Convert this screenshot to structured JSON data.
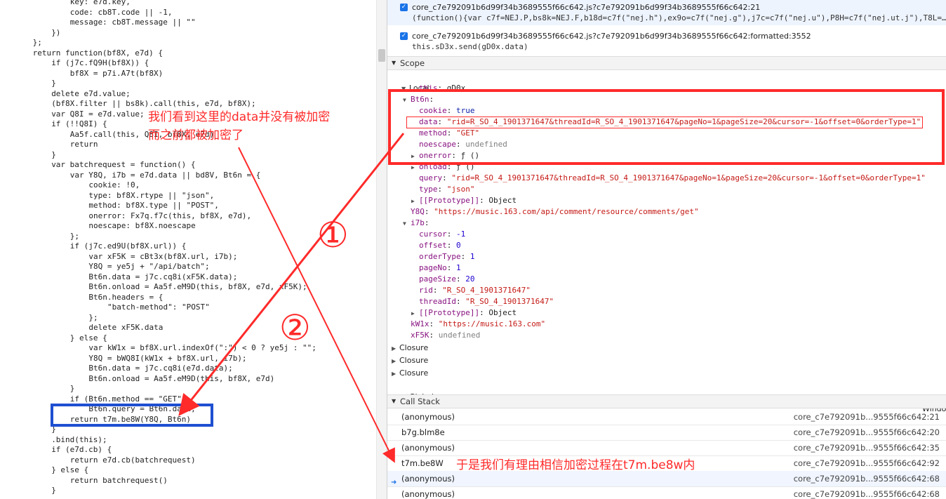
{
  "source_code": [
    {
      "indent": 12,
      "text": "key: e7d.key,"
    },
    {
      "indent": 12,
      "text": "code: cb8T.code || -1,"
    },
    {
      "indent": 12,
      "text": "message: cb8T.message || \"\""
    },
    {
      "indent": 8,
      "text": "})"
    },
    {
      "indent": 4,
      "text": "};"
    },
    {
      "indent": 4,
      "text": "return function(bf8X, e7d) {"
    },
    {
      "indent": 8,
      "text": "if (j7c.fQ9H(bf8X)) {"
    },
    {
      "indent": 12,
      "text": "bf8X = p7i.A7t(bf8X)"
    },
    {
      "indent": 8,
      "text": "}"
    },
    {
      "indent": 8,
      "text": "delete e7d.value;"
    },
    {
      "indent": 8,
      "text": "(bf8X.filter || bs8k).call(this, e7d, bf8X);"
    },
    {
      "indent": 8,
      "text": "var Q8I = e7d.value;"
    },
    {
      "indent": 8,
      "text": "if (!!Q8I) {"
    },
    {
      "indent": 12,
      "text": "Aa5f.call(this, Q8I, bf8X, e7d)"
    },
    {
      "indent": 12,
      "text": "return"
    },
    {
      "indent": 8,
      "text": "}"
    },
    {
      "indent": 8,
      "text": "var batchrequest = function() {"
    },
    {
      "indent": 12,
      "text": "var Y8Q, i7b = e7d.data || bd8V, Bt6n = {"
    },
    {
      "indent": 16,
      "text": "cookie: !0,"
    },
    {
      "indent": 16,
      "text": "type: bf8X.rtype || \"json\","
    },
    {
      "indent": 16,
      "text": "method: bf8X.type || \"POST\","
    },
    {
      "indent": 16,
      "text": "onerror: Fx7q.f7c(this, bf8X, e7d),"
    },
    {
      "indent": 16,
      "text": "noescape: bf8X.noescape"
    },
    {
      "indent": 12,
      "text": "};"
    },
    {
      "indent": 12,
      "text": "if (j7c.ed9U(bf8X.url)) {"
    },
    {
      "indent": 16,
      "text": "var xF5K = cBt3x(bf8X.url, i7b);"
    },
    {
      "indent": 16,
      "text": "Y8Q = ye5j + \"/api/batch\";"
    },
    {
      "indent": 16,
      "text": "Bt6n.data = j7c.cq8i(xF5K.data);"
    },
    {
      "indent": 16,
      "text": "Bt6n.onload = Aa5f.eM9D(this, bf8X, e7d, xF5K);"
    },
    {
      "indent": 16,
      "text": "Bt6n.headers = {"
    },
    {
      "indent": 20,
      "text": "\"batch-method\": \"POST\""
    },
    {
      "indent": 16,
      "text": "};"
    },
    {
      "indent": 16,
      "text": "delete xF5K.data"
    },
    {
      "indent": 12,
      "text": "} else {"
    },
    {
      "indent": 16,
      "text": "var kW1x = bf8X.url.indexOf(\":\") < 0 ? ye5j : \"\";"
    },
    {
      "indent": 16,
      "text": "Y8Q = bWQ8I(kW1x + bf8X.url, i7b);"
    },
    {
      "indent": 16,
      "text": "Bt6n.data = j7c.cq8i(e7d.data);"
    },
    {
      "indent": 16,
      "text": "Bt6n.onload = Aa5f.eM9D(this, bf8X, e7d)"
    },
    {
      "indent": 12,
      "text": "}"
    },
    {
      "indent": 12,
      "text": "if (Bt6n.method == \"GET\")"
    },
    {
      "indent": 16,
      "text": "Bt6n.query = Bt6n.data;"
    },
    {
      "indent": 12,
      "text": "return t7m.be8W(Y8Q, Bt6n)"
    },
    {
      "indent": 8,
      "text": "}"
    },
    {
      "indent": 8,
      "text": ".bind(this);"
    },
    {
      "indent": 8,
      "text": "if (e7d.cb) {"
    },
    {
      "indent": 12,
      "text": "return e7d.cb(batchrequest)"
    },
    {
      "indent": 8,
      "text": "} else {"
    },
    {
      "indent": 12,
      "text": "return batchrequest()"
    },
    {
      "indent": 8,
      "text": "}"
    }
  ],
  "breakpoints": [
    {
      "file": "core_c7e792091b6d99f34b3689555f66c642.js?c7e792091b6d99f34b3689555f66c642:21",
      "code": "(function(){var c7f=NEJ.P,bs8k=NEJ.F,b18d=c7f(\"nej.h\"),ex9o=c7f(\"nej.g\"),j7c=c7f(\"nej.u\"),P8H=c7f(\"nej.ut.j\"),T8L=…"
    },
    {
      "file": "core_c7e792091b6d99f34b3689555f66c642.js?c7e792091b6d99f34b3689555f66c642:formatted:3552",
      "code": "this.sD3x.send(gD0x.data)"
    }
  ],
  "scope": {
    "header": "Scope",
    "local_label": "Local",
    "lines": [
      {
        "indent": 2,
        "toggle": "",
        "name": "this",
        "value": "gD0x",
        "vclass": "plain"
      },
      {
        "indent": 1,
        "toggle": "▼",
        "name": "Bt6n",
        "value": "",
        "vclass": "plain"
      },
      {
        "indent": 2,
        "toggle": "",
        "name": "cookie",
        "value": "true",
        "vclass": "kw"
      },
      {
        "indent": 2,
        "toggle": "",
        "name": "data",
        "value": "\"rid=R_SO_4_1901371647&threadId=R_SO_4_1901371647&pageNo=1&pageSize=20&cursor=-1&offset=0&orderType=1\"",
        "vclass": "str"
      },
      {
        "indent": 2,
        "toggle": "",
        "name": "method",
        "value": "\"GET\"",
        "vclass": "str"
      },
      {
        "indent": 2,
        "toggle": "",
        "name": "noescape",
        "value": "undefined",
        "vclass": "undef"
      },
      {
        "indent": 2,
        "toggle": "▶",
        "name": "onerror",
        "value": "ƒ ()",
        "vclass": "plain"
      },
      {
        "indent": 2,
        "toggle": "▶",
        "name": "onload",
        "value": "ƒ ()",
        "vclass": "plain"
      },
      {
        "indent": 2,
        "toggle": "",
        "name": "query",
        "value": "\"rid=R_SO_4_1901371647&threadId=R_SO_4_1901371647&pageNo=1&pageSize=20&cursor=-1&offset=0&orderType=1\"",
        "vclass": "str"
      },
      {
        "indent": 2,
        "toggle": "",
        "name": "type",
        "value": "\"json\"",
        "vclass": "str"
      },
      {
        "indent": 2,
        "toggle": "▶",
        "name": "[[Prototype]]",
        "value": "Object",
        "vclass": "plain"
      },
      {
        "indent": 1,
        "toggle": "",
        "name": "Y8Q",
        "value": "\"https://music.163.com/api/comment/resource/comments/get\"",
        "vclass": "str"
      },
      {
        "indent": 1,
        "toggle": "▼",
        "name": "i7b",
        "value": "",
        "vclass": "plain"
      },
      {
        "indent": 2,
        "toggle": "",
        "name": "cursor",
        "value": "-1",
        "vclass": "num"
      },
      {
        "indent": 2,
        "toggle": "",
        "name": "offset",
        "value": "0",
        "vclass": "num"
      },
      {
        "indent": 2,
        "toggle": "",
        "name": "orderType",
        "value": "1",
        "vclass": "num"
      },
      {
        "indent": 2,
        "toggle": "",
        "name": "pageNo",
        "value": "1",
        "vclass": "num"
      },
      {
        "indent": 2,
        "toggle": "",
        "name": "pageSize",
        "value": "20",
        "vclass": "num"
      },
      {
        "indent": 2,
        "toggle": "",
        "name": "rid",
        "value": "\"R_SO_4_1901371647\"",
        "vclass": "str"
      },
      {
        "indent": 2,
        "toggle": "",
        "name": "threadId",
        "value": "\"R_SO_4_1901371647\"",
        "vclass": "str"
      },
      {
        "indent": 2,
        "toggle": "▶",
        "name": "[[Prototype]]",
        "value": "Object",
        "vclass": "plain"
      },
      {
        "indent": 1,
        "toggle": "",
        "name": "kW1x",
        "value": "\"https://music.163.com\"",
        "vclass": "str"
      },
      {
        "indent": 1,
        "toggle": "",
        "name": "xF5K",
        "value": "undefined",
        "vclass": "undef"
      }
    ],
    "closures": [
      "Closure",
      "Closure",
      "Closure"
    ],
    "global": {
      "label": "Global",
      "value": "Window"
    }
  },
  "call_stack": {
    "header": "Call Stack",
    "frames": [
      {
        "fn": "(anonymous)",
        "loc": "core_c7e792091b...9555f66c642:21",
        "current": false
      },
      {
        "fn": "b7g.blm8e",
        "loc": "core_c7e792091b...9555f66c642:20",
        "current": false
      },
      {
        "fn": "(anonymous)",
        "loc": "core_c7e792091b...9555f66c642:35",
        "current": false
      },
      {
        "fn": "t7m.be8W",
        "loc": "core_c7e792091b...9555f66c642:92",
        "current": false
      },
      {
        "fn": "(anonymous)",
        "loc": "core_c7e792091b...9555f66c642:68",
        "current": true
      },
      {
        "fn": "(anonymous)",
        "loc": "core_c7e792091b...9555f66c642:68",
        "current": false
      }
    ]
  },
  "annotations": {
    "note1_line1": "我们看到这里的data并没有被加密",
    "note1_line2": "而之前都被加密了",
    "circled_1": "①",
    "circled_2": "②",
    "note2": "于是我们有理由相信加密过程在t7m.be8w内"
  },
  "colors": {
    "annotation_red": "#ff2a2a",
    "annotation_blue": "#1f4fd1",
    "checkbox_blue": "#1a73e8"
  }
}
